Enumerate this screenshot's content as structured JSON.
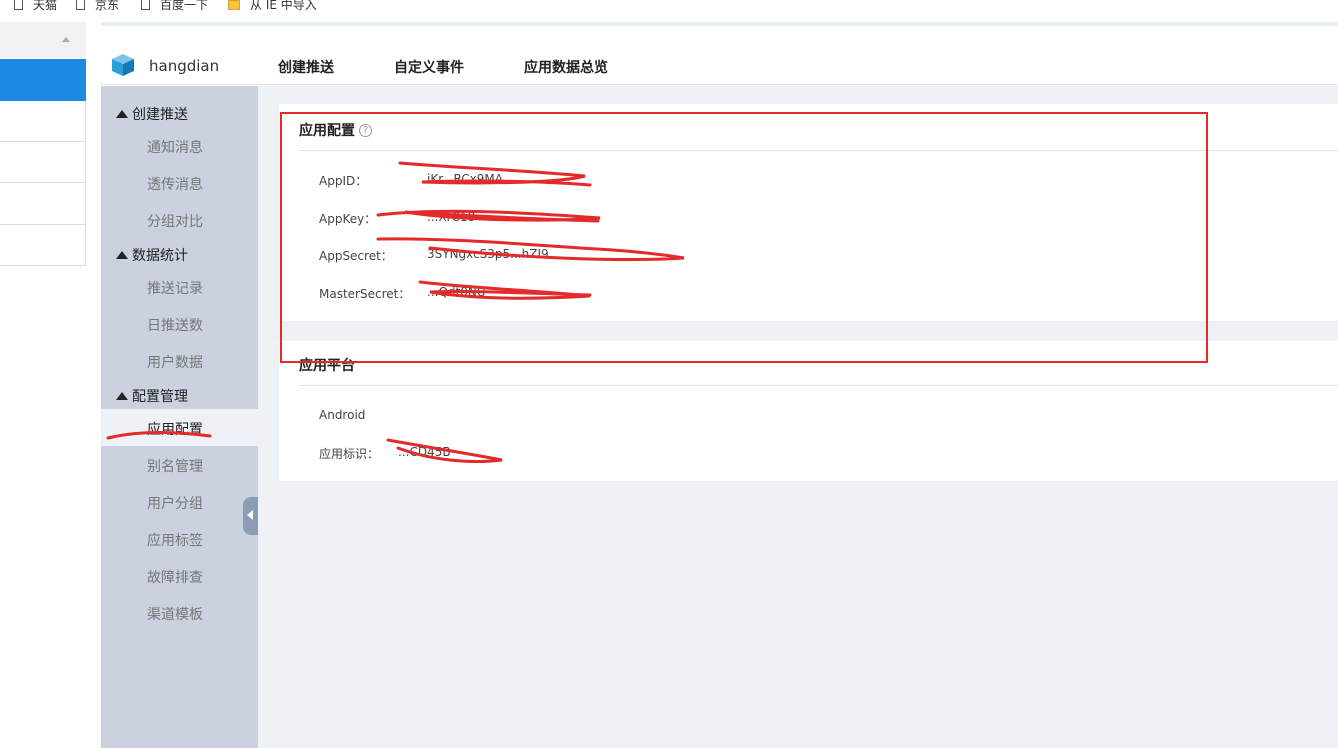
{
  "bookmarks": [
    {
      "label": "天猫",
      "icon": "page-icon"
    },
    {
      "label": "京东",
      "icon": "page-icon"
    },
    {
      "label": "百度一下",
      "icon": "page-icon"
    },
    {
      "label": "从 IE 中导入",
      "icon": "folder-icon"
    }
  ],
  "header": {
    "brand": "hangdian",
    "nav": [
      "创建推送",
      "自定义事件",
      "应用数据总览"
    ]
  },
  "sidebar": {
    "sections": [
      {
        "title": "创建推送",
        "items": [
          "通知消息",
          "透传消息",
          "分组对比"
        ]
      },
      {
        "title": "数据统计",
        "items": [
          "推送记录",
          "日推送数",
          "用户数据"
        ]
      },
      {
        "title": "配置管理",
        "items": [
          "应用配置",
          "别名管理",
          "用户分组",
          "应用标签",
          "故障排查",
          "渠道模板"
        ]
      }
    ],
    "active_item": "应用配置"
  },
  "app_config": {
    "title": "应用配置",
    "help": "?",
    "rows": [
      {
        "label": "AppID：",
        "value": "iKr...RCx9MA"
      },
      {
        "label": "AppKey：",
        "value": "...XrC18"
      },
      {
        "label": "AppSecret：",
        "value": "3SYNgxcS3p5...hZI9"
      },
      {
        "label": "MasterSecret：",
        "value": "...Qdt0NU"
      }
    ]
  },
  "app_platform": {
    "title": "应用平台",
    "platform": "Android",
    "id_label": "应用标识：",
    "id_value": "...CD45B"
  },
  "colors": {
    "sidebar_bg": "#c9d2de",
    "content_bg": "#eef2f6",
    "annotation_red": "#e42a2a",
    "logo_blue": "#2a9fd8"
  }
}
